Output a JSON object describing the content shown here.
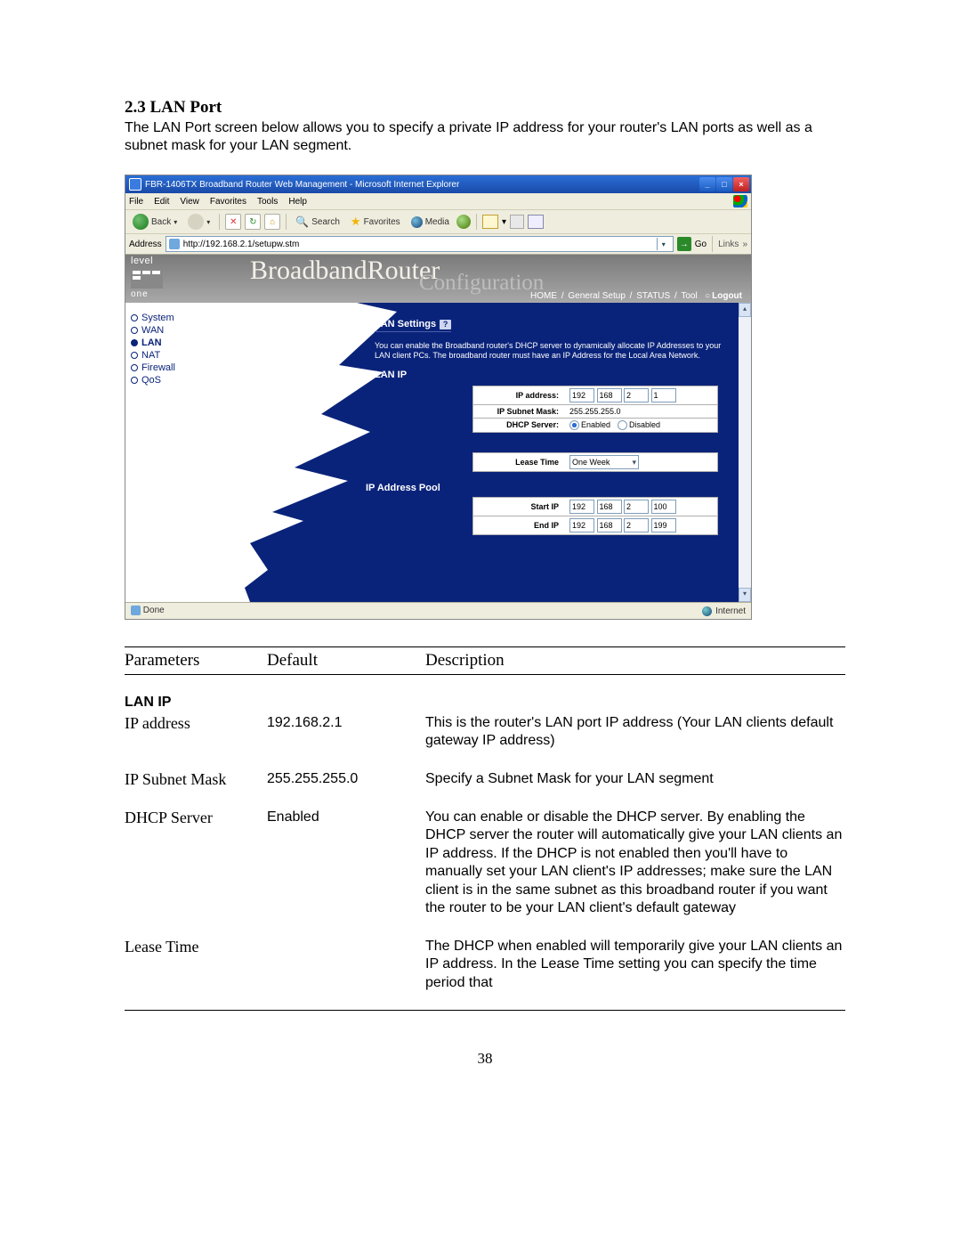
{
  "doc": {
    "section_heading": "2.3 LAN Port",
    "intro": "The LAN Port screen below allows you to specify a private IP address for your router's LAN ports as well as a subnet mask for your LAN segment.",
    "page_number": "38"
  },
  "param_table": {
    "headers": {
      "param": "Parameters",
      "def": "Default",
      "desc": "Description"
    },
    "subhead": "LAN IP",
    "rows": [
      {
        "param": "IP address",
        "def": "192.168.2.1",
        "desc": "This is the router's LAN port IP address (Your LAN clients default gateway IP address)"
      },
      {
        "param": "IP Subnet Mask",
        "def": "255.255.255.0",
        "desc": "Specify a Subnet Mask for your LAN segment"
      },
      {
        "param": "DHCP Server",
        "def": "Enabled",
        "desc": "You can enable or disable the DHCP server. By enabling the DHCP server the router will automatically give your LAN clients an IP address. If the DHCP is not enabled then you'll have to manually set your LAN client's IP addresses; make sure the LAN client is in the same subnet as this broadband router if you want the router to be your LAN client's default gateway"
      },
      {
        "param": "Lease Time",
        "def": "",
        "desc": "The DHCP when enabled will temporarily give your LAN clients an IP address. In the Lease Time setting you can specify the time period that"
      }
    ]
  },
  "ie": {
    "title": "FBR-1406TX Broadband Router Web Management - Microsoft Internet Explorer",
    "menus": [
      "File",
      "Edit",
      "View",
      "Favorites",
      "Tools",
      "Help"
    ],
    "toolbar": {
      "back": "Back",
      "search": "Search",
      "favorites": "Favorites",
      "media": "Media"
    },
    "addressbar": {
      "label": "Address",
      "url": "http://192.168.2.1/setupw.stm",
      "go": "Go",
      "links": "Links",
      "linkssym": "»"
    },
    "status": {
      "left": "Done",
      "zone": "Internet"
    }
  },
  "router": {
    "logo_top": "level",
    "logo_bottom": "one",
    "brand_big": "BroadbandRouter",
    "brand_sub": "Configuration",
    "toplinks": {
      "home": "HOME",
      "setup": "General Setup",
      "status": "STATUS",
      "tool": "Tool",
      "logout": "Logout"
    },
    "nav": {
      "system": "System",
      "wan": "WAN",
      "lan": "LAN",
      "nat": "NAT",
      "firewall": "Firewall",
      "qos": "QoS"
    },
    "content": {
      "heading": "LAN Settings",
      "help_badge": "?",
      "desc": "You can enable the Broadband router's DHCP server to dynamically allocate IP Addresses to your LAN client PCs. The broadband router must have an IP Address for the Local Area Network.",
      "lan_ip_head": "LAN IP",
      "fields": {
        "ip_label": "IP address:",
        "ip": [
          "192",
          "168",
          "2",
          "1"
        ],
        "mask_label": "IP Subnet Mask:",
        "mask": "255.255.255.0",
        "dhcp_label": "DHCP Server:",
        "dhcp_enabled": "Enabled",
        "dhcp_disabled": "Disabled",
        "lease_label": "Lease Time",
        "lease_value": "One Week"
      },
      "pool_head": "IP Address Pool",
      "pool": {
        "start_label": "Start IP",
        "start": [
          "192",
          "168",
          "2",
          "100"
        ],
        "end_label": "End IP",
        "end": [
          "192",
          "168",
          "2",
          "199"
        ]
      }
    }
  }
}
